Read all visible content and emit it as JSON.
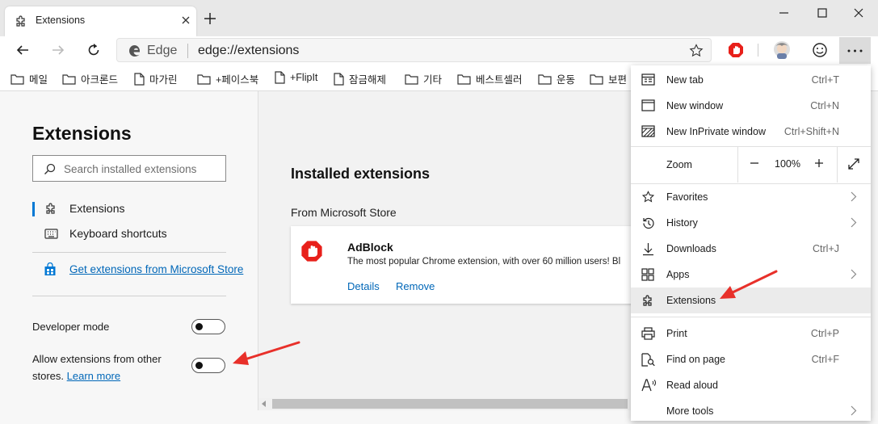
{
  "browser": {
    "tab_title": "Extensions",
    "address_label": "Edge",
    "url": "edge://extensions"
  },
  "bookmarks": [
    {
      "label": "메일",
      "icon": "folder-icon"
    },
    {
      "label": "아크론드",
      "icon": "folder-icon"
    },
    {
      "label": "마가린",
      "icon": "page-icon"
    },
    {
      "label": "+페이스북",
      "icon": "folder-icon"
    },
    {
      "label": "+FlipIt",
      "icon": "page-icon"
    },
    {
      "label": "잠금해제",
      "icon": "page-icon"
    },
    {
      "label": "기타",
      "icon": "folder-icon"
    },
    {
      "label": "베스트셀러",
      "icon": "folder-icon"
    },
    {
      "label": "운동",
      "icon": "folder-icon"
    },
    {
      "label": "보편",
      "icon": "folder-icon"
    }
  ],
  "sidebar": {
    "title": "Extensions",
    "search_placeholder": "Search installed extensions",
    "nav": [
      {
        "label": "Extensions",
        "icon": "puzzle-icon",
        "selected": true
      },
      {
        "label": "Keyboard shortcuts",
        "icon": "keyboard-icon",
        "selected": false
      }
    ],
    "store_link": "Get extensions from Microsoft Store",
    "developer_mode": {
      "label": "Developer mode",
      "on": false
    },
    "allow_other": {
      "label": "Allow extensions from other stores.",
      "learn_more": "Learn more",
      "on": false
    }
  },
  "main": {
    "heading": "Installed extensions",
    "section": "From Microsoft Store",
    "extension": {
      "name": "AdBlock",
      "description": "The most popular Chrome extension, with over 60 million users! Bl",
      "details": "Details",
      "remove": "Remove"
    }
  },
  "menu": {
    "new_tab": {
      "label": "New tab",
      "shortcut": "Ctrl+T"
    },
    "new_window": {
      "label": "New window",
      "shortcut": "Ctrl+N"
    },
    "inprivate": {
      "label": "New InPrivate window",
      "shortcut": "Ctrl+Shift+N"
    },
    "zoom": {
      "label": "Zoom",
      "value": "100%"
    },
    "favorites": {
      "label": "Favorites"
    },
    "history": {
      "label": "History"
    },
    "downloads": {
      "label": "Downloads",
      "shortcut": "Ctrl+J"
    },
    "apps": {
      "label": "Apps"
    },
    "extensions": {
      "label": "Extensions"
    },
    "print": {
      "label": "Print",
      "shortcut": "Ctrl+P"
    },
    "find": {
      "label": "Find on page",
      "shortcut": "Ctrl+F"
    },
    "read_aloud": {
      "label": "Read aloud"
    },
    "more_tools": {
      "label": "More tools"
    }
  },
  "colors": {
    "accent": "#0078d4",
    "link": "#0067b8",
    "annotation": "#e8302a",
    "adblock": "#e8201a"
  }
}
